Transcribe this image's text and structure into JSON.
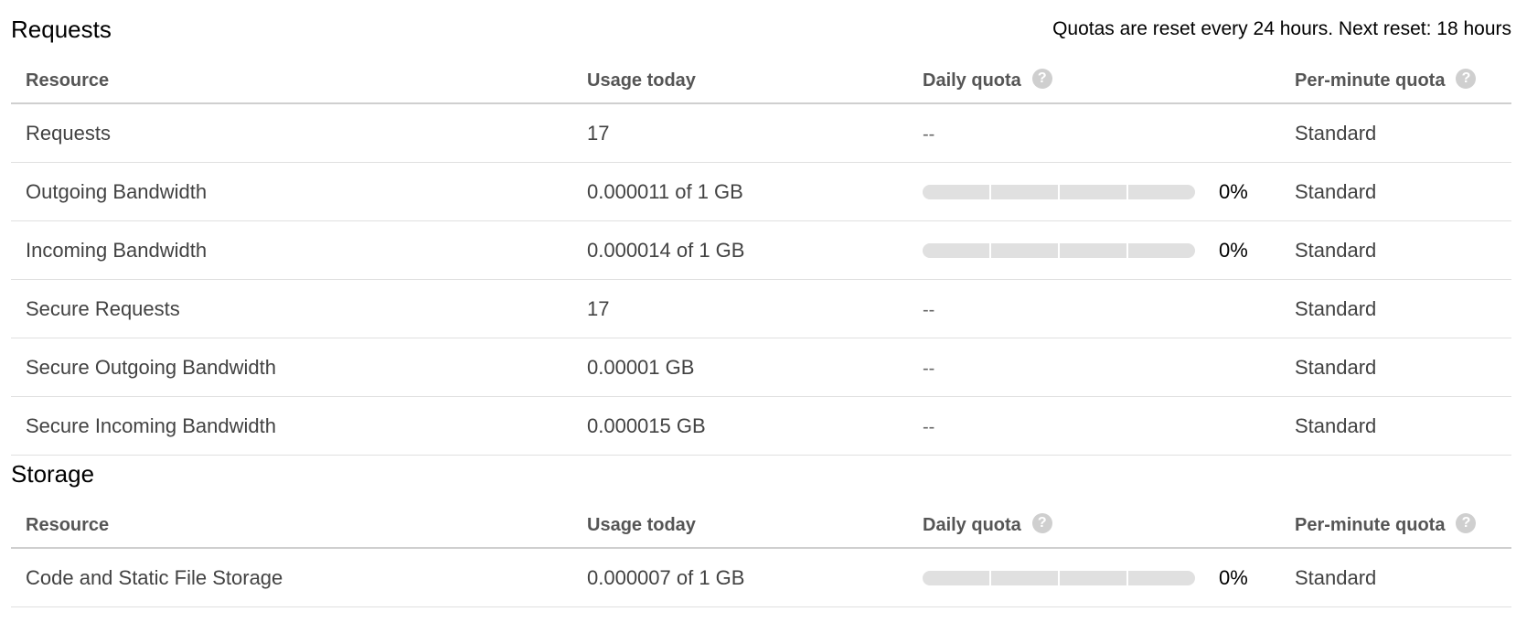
{
  "requests": {
    "title": "Requests",
    "reset_note": "Quotas are reset every 24 hours. Next reset: 18 hours",
    "columns": [
      "Resource",
      "Usage today",
      "Daily quota",
      "Per-minute quota"
    ],
    "rows": [
      {
        "resource": "Requests",
        "usage": "17",
        "daily": "--",
        "daily_progress": null,
        "daily_pct": "",
        "per_minute": "Standard"
      },
      {
        "resource": "Outgoing Bandwidth",
        "usage": "0.000011 of 1 GB",
        "daily": "",
        "daily_progress": 0,
        "daily_pct": "0%",
        "per_minute": "Standard"
      },
      {
        "resource": "Incoming Bandwidth",
        "usage": "0.000014 of 1 GB",
        "daily": "",
        "daily_progress": 0,
        "daily_pct": "0%",
        "per_minute": "Standard"
      },
      {
        "resource": "Secure Requests",
        "usage": "17",
        "daily": "--",
        "daily_progress": null,
        "daily_pct": "",
        "per_minute": "Standard"
      },
      {
        "resource": "Secure Outgoing Bandwidth",
        "usage": "0.00001 GB",
        "daily": "--",
        "daily_progress": null,
        "daily_pct": "",
        "per_minute": "Standard"
      },
      {
        "resource": "Secure Incoming Bandwidth",
        "usage": "0.000015 GB",
        "daily": "--",
        "daily_progress": null,
        "daily_pct": "",
        "per_minute": "Standard"
      }
    ]
  },
  "storage": {
    "title": "Storage",
    "columns": [
      "Resource",
      "Usage today",
      "Daily quota",
      "Per-minute quota"
    ],
    "rows": [
      {
        "resource": "Code and Static File Storage",
        "usage": "0.000007 of 1 GB",
        "daily": "",
        "daily_progress": 0,
        "daily_pct": "0%",
        "per_minute": "Standard"
      }
    ]
  },
  "help_icon": {
    "glyph": "?",
    "name": "help-circle-icon"
  },
  "colors": {
    "progress_track": "#e0e0e0",
    "progress_fill": "#4285f4",
    "help_icon_bg": "#cfcfcf",
    "header_border": "#cfcfcf",
    "row_border": "#e0e0e0"
  }
}
